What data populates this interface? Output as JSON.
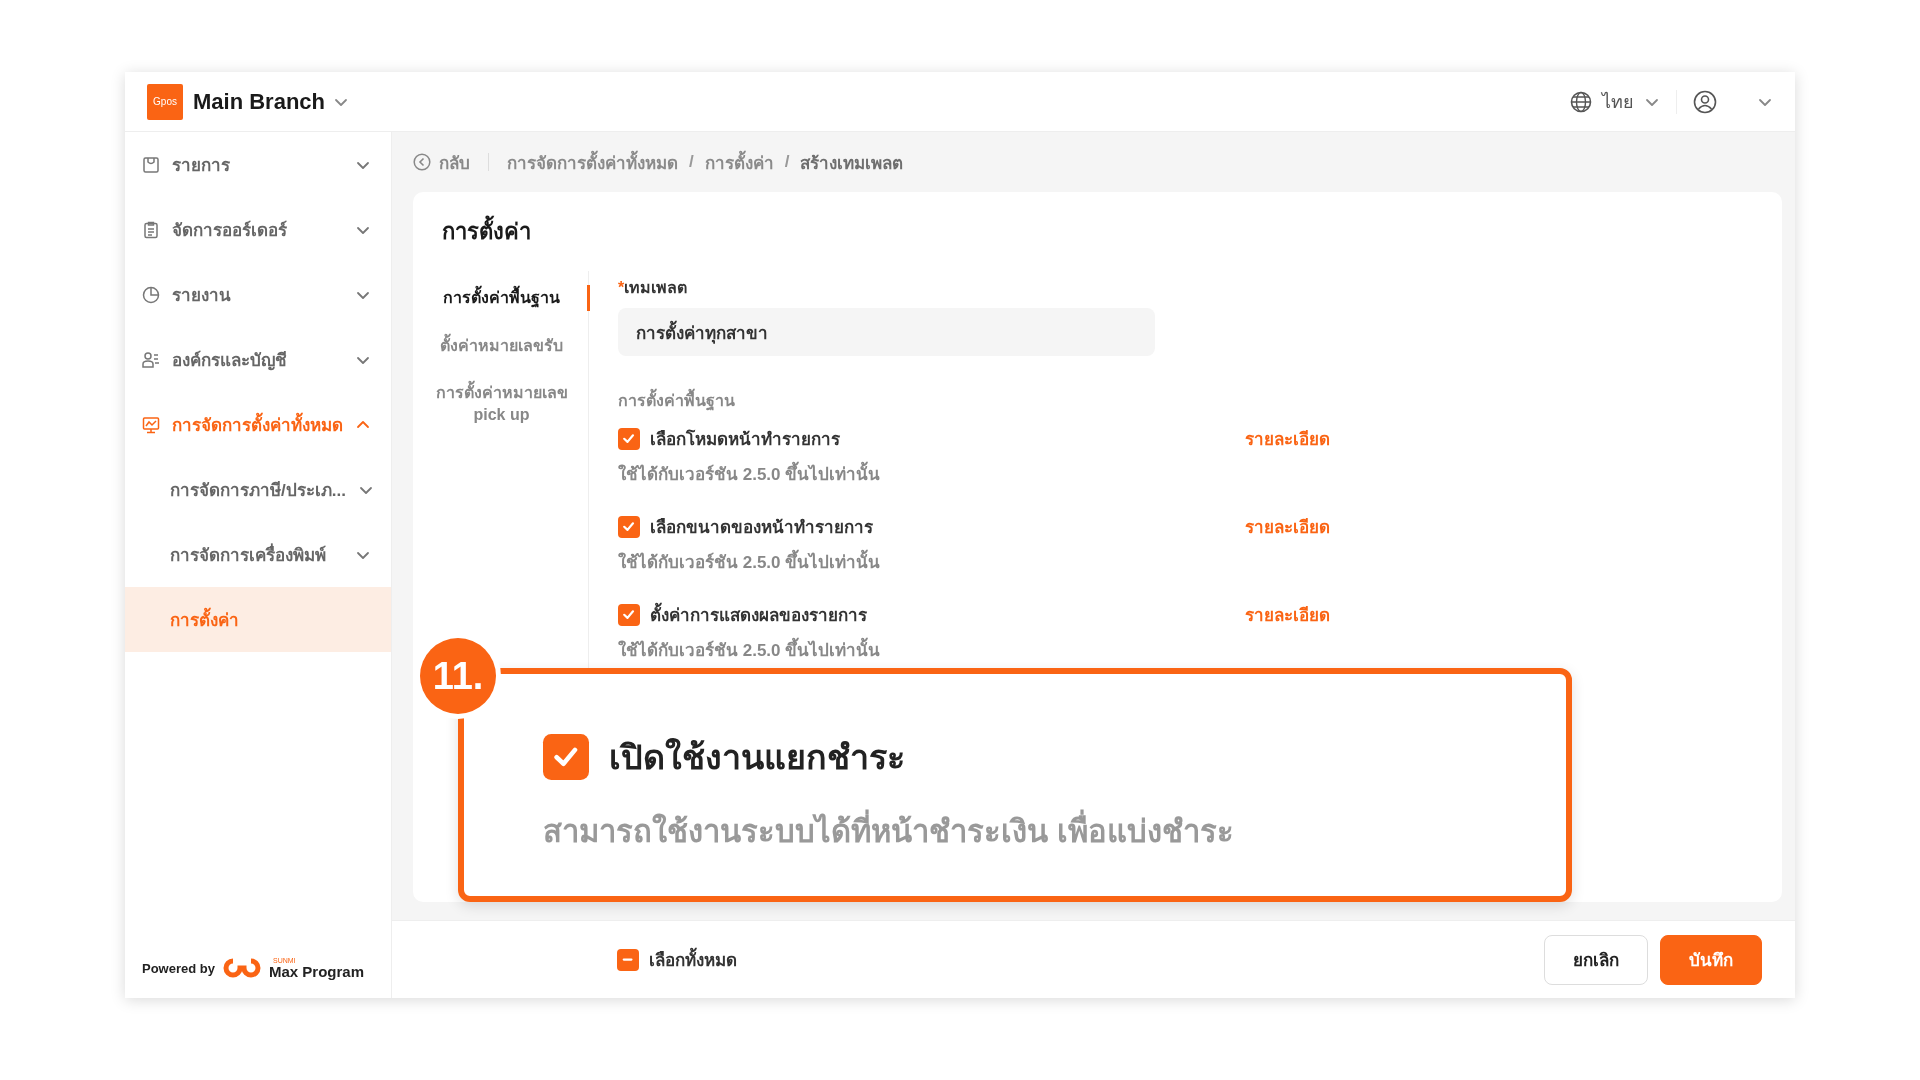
{
  "header": {
    "logo_text": "Gpos",
    "branch": "Main Branch",
    "language": "ไทย"
  },
  "sidebar": {
    "items": [
      {
        "label": "รายการ",
        "expanded": false,
        "selected": false
      },
      {
        "label": "จัดการออร์เดอร์",
        "expanded": false,
        "selected": false
      },
      {
        "label": "รายงาน",
        "expanded": false,
        "selected": false
      },
      {
        "label": "องค์กรและบัญชี",
        "expanded": false,
        "selected": false
      },
      {
        "label": "การจัดการตั้งค่าทั้งหมด",
        "expanded": true,
        "selected": true,
        "children": [
          {
            "label": "การจัดการภาษี/ประเภ...",
            "expanded": false,
            "selected": false
          },
          {
            "label": "การจัดการเครื่องพิมพ์",
            "expanded": false,
            "selected": false
          },
          {
            "label": "การตั้งค่า",
            "selected": true
          }
        ]
      }
    ],
    "footer": {
      "powered_by": "Powered by",
      "brand_small": "SUNMI",
      "brand": "Max Program"
    }
  },
  "breadcrumb": {
    "back": "กลับ",
    "path": [
      {
        "kind": "link",
        "text": "การจัดการตั้งค่าทั้งหมด"
      },
      {
        "kind": "separator",
        "text": "/"
      },
      {
        "kind": "link",
        "text": "การตั้งค่า"
      },
      {
        "kind": "separator",
        "text": "/"
      },
      {
        "kind": "current",
        "text": "สร้างเทมเพลต"
      }
    ]
  },
  "card": {
    "title": "การตั้งค่า",
    "tabs": [
      {
        "label": "การตั้งค่าพื้นฐาน",
        "selected": true
      },
      {
        "label": "ตั้งค่าหมายเลขรับ",
        "selected": false
      },
      {
        "label": "การตั้งค่าหมายเลข pick up",
        "selected": false
      }
    ],
    "template": {
      "required_mark": "*",
      "label": "เทมเพลต",
      "value": "การตั้งค่าทุกสาขา"
    },
    "section_title": "การตั้งค่าพื้นฐาน",
    "options": [
      {
        "label": "เลือกโหมดหน้าทำรายการ",
        "note": "ใช้ได้กับเวอร์ชัน 2.5.0 ขึ้นไปเท่านั้น",
        "checked": true,
        "link": "รายละเอียด"
      },
      {
        "label": "เลือกขนาดของหน้าทำรายการ",
        "note": "ใช้ได้กับเวอร์ชัน 2.5.0 ขึ้นไปเท่านั้น",
        "checked": true,
        "link": "รายละเอียด"
      },
      {
        "label": "ตั้งค่าการแสดงผลของรายการ",
        "note": "ใช้ได้กับเวอร์ชัน 2.5.0 ขึ้นไปเท่านั้น",
        "checked": true,
        "link": "รายละเอียด"
      }
    ]
  },
  "callout": {
    "number": "11.",
    "label": "เปิดใช้งานแยกชำระ",
    "note": "สามารถใช้งานระบบได้ที่หน้าชำระเงิน เพื่อแบ่งชำระ",
    "checked": true
  },
  "footer": {
    "select_all": {
      "label": "เลือกทั้งหมด",
      "indeterminate": true
    },
    "buttons": [
      {
        "label": "ยกเลิก",
        "kind": "secondary"
      },
      {
        "label": "บันทึก",
        "kind": "primary"
      }
    ]
  }
}
